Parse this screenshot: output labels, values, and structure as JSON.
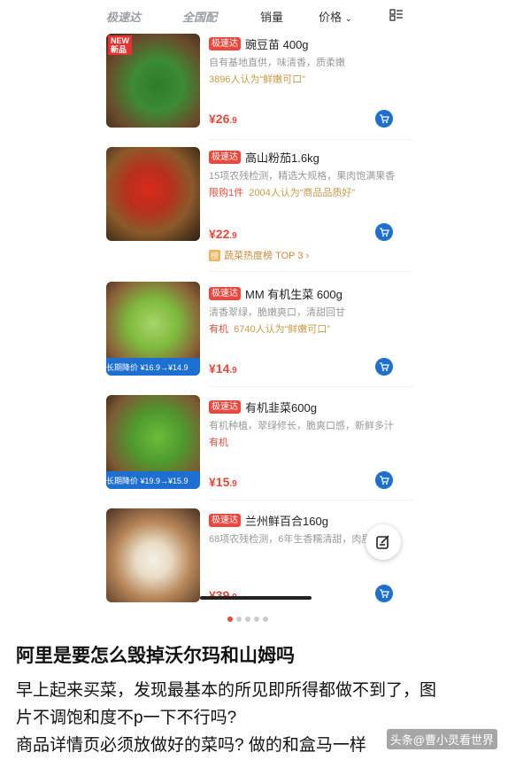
{
  "tabs": {
    "speed": "极速达",
    "national": "全国配",
    "sales": "销量",
    "price": "价格"
  },
  "products": [
    {
      "tag": "极速达",
      "title": "豌豆苗 400g",
      "desc": "自有基地直供，味清香，质柔嫩",
      "sub_red": "",
      "sub_gold": "3896人认为“鲜嫩可口”",
      "price": "¥26",
      "price_dec": ".9",
      "new_badge": "NEW\n新品"
    },
    {
      "tag": "极速达",
      "title": "高山粉茄1.6kg",
      "desc": "15项农残检测，精选大规格，果肉饱满果香",
      "sub_red": "限购1件",
      "sub_gold": "2004人认为“商品品质好”",
      "price": "¥22",
      "price_dec": ".9",
      "rank_badge": "榜",
      "rank_text": "蔬菜热度榜 TOP 3 ›"
    },
    {
      "tag": "极速达",
      "title": "MM 有机生菜 600g",
      "desc": "清香翠绿，脆嫩爽口，清甜回甘",
      "sub_red": "有机",
      "sub_gold": "6740人认为“鲜嫩可口”",
      "price": "¥14",
      "price_dec": ".9",
      "promo": "长期降价 ¥16.9→¥14.9"
    },
    {
      "tag": "极速达",
      "title": "有机韭菜600g",
      "desc": "有机种植，翠绿修长，脆爽口感，新鲜多汁",
      "sub_red": "有机",
      "sub_gold": "",
      "price": "¥15",
      "price_dec": ".9",
      "promo": "长期降价 ¥19.9→¥15.9"
    },
    {
      "tag": "极速达",
      "title": "兰州鲜百合160g",
      "desc": "68项农残检测，6年生香糯清甜，肉质",
      "sub_red": "",
      "sub_gold": "",
      "price": "¥39",
      "price_dec": ".9"
    }
  ],
  "post": {
    "title": "阿里是要怎么毁掉沃尔玛和山姆吗",
    "line1": "早上起来买菜，发现最基本的所见即所得都做不到了，图",
    "line2": "片不调饱和度不p一下不行吗?",
    "line3": "商品详情页必须放做好的菜吗? 做的和盒马一样"
  },
  "watermark": "头条@曹小灵看世界",
  "colors": {
    "accent": "#e8493c",
    "cart": "#1d6fd1",
    "gold": "#c99b4a"
  }
}
